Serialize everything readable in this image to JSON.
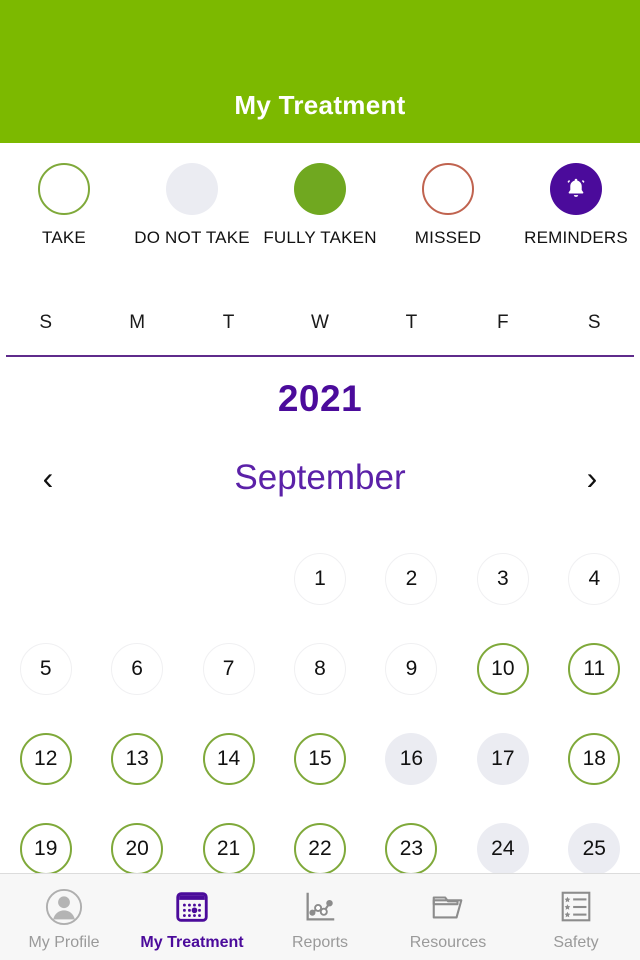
{
  "header": {
    "title": "My Treatment",
    "bg_color": "#7CB900"
  },
  "legend": {
    "items": [
      {
        "label": "TAKE",
        "style": "s-take",
        "icon": "empty-green-circle-icon"
      },
      {
        "label": "DO NOT TAKE",
        "style": "s-skip",
        "icon": "filled-gray-circle-icon"
      },
      {
        "label": "FULLY TAKEN",
        "style": "s-full",
        "icon": "filled-green-circle-icon"
      },
      {
        "label": "MISSED",
        "style": "s-missed",
        "icon": "empty-red-circle-icon"
      },
      {
        "label": "REMINDERS",
        "style": "s-remind",
        "icon": "bell-icon"
      }
    ]
  },
  "weekdays": [
    "S",
    "M",
    "T",
    "W",
    "T",
    "F",
    "S"
  ],
  "calendar": {
    "year": "2021",
    "month": "September",
    "prev_label": "‹",
    "next_label": "›",
    "accent_color": "#4B0B9B",
    "days": [
      {
        "label": "",
        "state": "empty"
      },
      {
        "label": "",
        "state": "empty"
      },
      {
        "label": "",
        "state": "empty"
      },
      {
        "label": "1",
        "state": "plain"
      },
      {
        "label": "2",
        "state": "plain"
      },
      {
        "label": "3",
        "state": "plain"
      },
      {
        "label": "4",
        "state": "plain"
      },
      {
        "label": "5",
        "state": "plain"
      },
      {
        "label": "6",
        "state": "plain"
      },
      {
        "label": "7",
        "state": "plain"
      },
      {
        "label": "8",
        "state": "plain"
      },
      {
        "label": "9",
        "state": "plain"
      },
      {
        "label": "10",
        "state": "take"
      },
      {
        "label": "11",
        "state": "take"
      },
      {
        "label": "12",
        "state": "take"
      },
      {
        "label": "13",
        "state": "take"
      },
      {
        "label": "14",
        "state": "take"
      },
      {
        "label": "15",
        "state": "take"
      },
      {
        "label": "16",
        "state": "skip"
      },
      {
        "label": "17",
        "state": "skip"
      },
      {
        "label": "18",
        "state": "take"
      },
      {
        "label": "19",
        "state": "take"
      },
      {
        "label": "20",
        "state": "take"
      },
      {
        "label": "21",
        "state": "take"
      },
      {
        "label": "22",
        "state": "take"
      },
      {
        "label": "23",
        "state": "take"
      },
      {
        "label": "24",
        "state": "skip"
      },
      {
        "label": "25",
        "state": "skip"
      }
    ]
  },
  "nav": {
    "items": [
      {
        "label": "My Profile",
        "icon": "person-icon",
        "active": false
      },
      {
        "label": "My Treatment",
        "icon": "calendar-icon",
        "active": true
      },
      {
        "label": "Reports",
        "icon": "chart-icon",
        "active": false
      },
      {
        "label": "Resources",
        "icon": "folder-icon",
        "active": false
      },
      {
        "label": "Safety",
        "icon": "checklist-icon",
        "active": false
      }
    ]
  }
}
